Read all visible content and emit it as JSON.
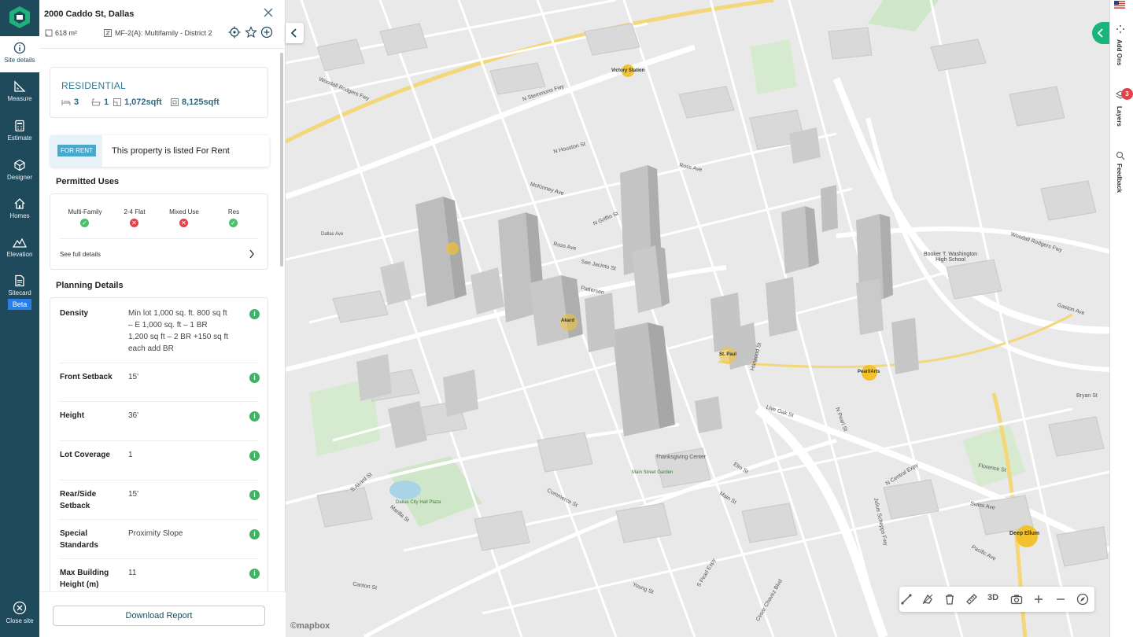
{
  "nav": {
    "items": [
      {
        "label": "Site details"
      },
      {
        "label": "Measure"
      },
      {
        "label": "Estimate"
      },
      {
        "label": "Designer"
      },
      {
        "label": "Homes"
      },
      {
        "label": "Elevation"
      },
      {
        "label": "Sitecard"
      }
    ],
    "beta": "Beta",
    "close": "Close site"
  },
  "site": {
    "address": "2000 Caddo St, Dallas",
    "area": "618 m²",
    "zoning": "MF-2(A): Multifamily - District 2"
  },
  "property": {
    "type": "RESIDENTIAL",
    "beds": "3",
    "baths": "1",
    "floor_area": "1,072sqft",
    "lot_area": "8,125sqft"
  },
  "listing": {
    "badge": "FOR RENT",
    "text": "This property is listed For Rent"
  },
  "permitted": {
    "title": "Permitted Uses",
    "uses": [
      {
        "label": "Multi-Family",
        "allowed": true
      },
      {
        "label": "2-4 Flat",
        "allowed": false
      },
      {
        "label": "Mixed Use",
        "allowed": false
      },
      {
        "label": "Res",
        "allowed": true
      }
    ],
    "see_full": "See full details"
  },
  "planning": {
    "title": "Planning Details",
    "rows": [
      {
        "label": "Density",
        "value": "Min lot 1,000 sq. ft. 800 sq ft – E 1,000 sq. ft – 1 BR 1,200 sq ft – 2 BR +150 sq ft each add BR"
      },
      {
        "label": "Front Setback",
        "value": "15'"
      },
      {
        "label": "Height",
        "value": "36'"
      },
      {
        "label": "Lot Coverage",
        "value": "1"
      },
      {
        "label": "Rear/Side Setback",
        "value": "15'"
      },
      {
        "label": "Special Standards",
        "value": "Proximity Slope"
      },
      {
        "label": "Max Building Height (m)",
        "value": "11"
      }
    ]
  },
  "download": "Download Report",
  "map": {
    "labels": [
      "Victory Station",
      "N Stemmons Fwy",
      "N Houston St",
      "Woodall Rodgers Fwy",
      "McKinney Ave",
      "N Griffin St",
      "Ross Ave",
      "San Jacinto St",
      "Pattersen",
      "N Pearl St",
      "Akard",
      "St. Paul",
      "Pearl/Arts",
      "Booker T. Washington High School",
      "Bryan St",
      "Elm St",
      "Main St",
      "Commerce St",
      "Marilla St",
      "Young St",
      "Canton St",
      "Dallas City Hall Plaza",
      "S Akard St",
      "Pacific Ave",
      "N Central Expy",
      "Julius Schepps Fwy",
      "Swiss Ave",
      "Live Oak St",
      "Florence St",
      "Deep Ellum",
      "Gaston Ave",
      "Ross Ave",
      "Cesar Chavez Blvd",
      "S Pearl Expy",
      "Main Street Garden",
      "Thanksgiving Center",
      "Harwood St",
      "Woodall Rodgers Fwy",
      "Dallas Ave"
    ],
    "toolbar_3d": "3D",
    "attribution": "©mapbox"
  },
  "rail": {
    "add_ons": "Add Ons",
    "layers": "Layers",
    "layers_count": "3",
    "feedback": "Feedback"
  },
  "colors": {
    "nav_bg": "#1f4a5c",
    "accent": "#2d7a92",
    "green": "#4cbf6a",
    "red": "#e0434b",
    "map_road": "#ffffff",
    "map_highway": "#e8c24a",
    "park": "#cfe6c8",
    "tab_green": "#19b57d"
  }
}
